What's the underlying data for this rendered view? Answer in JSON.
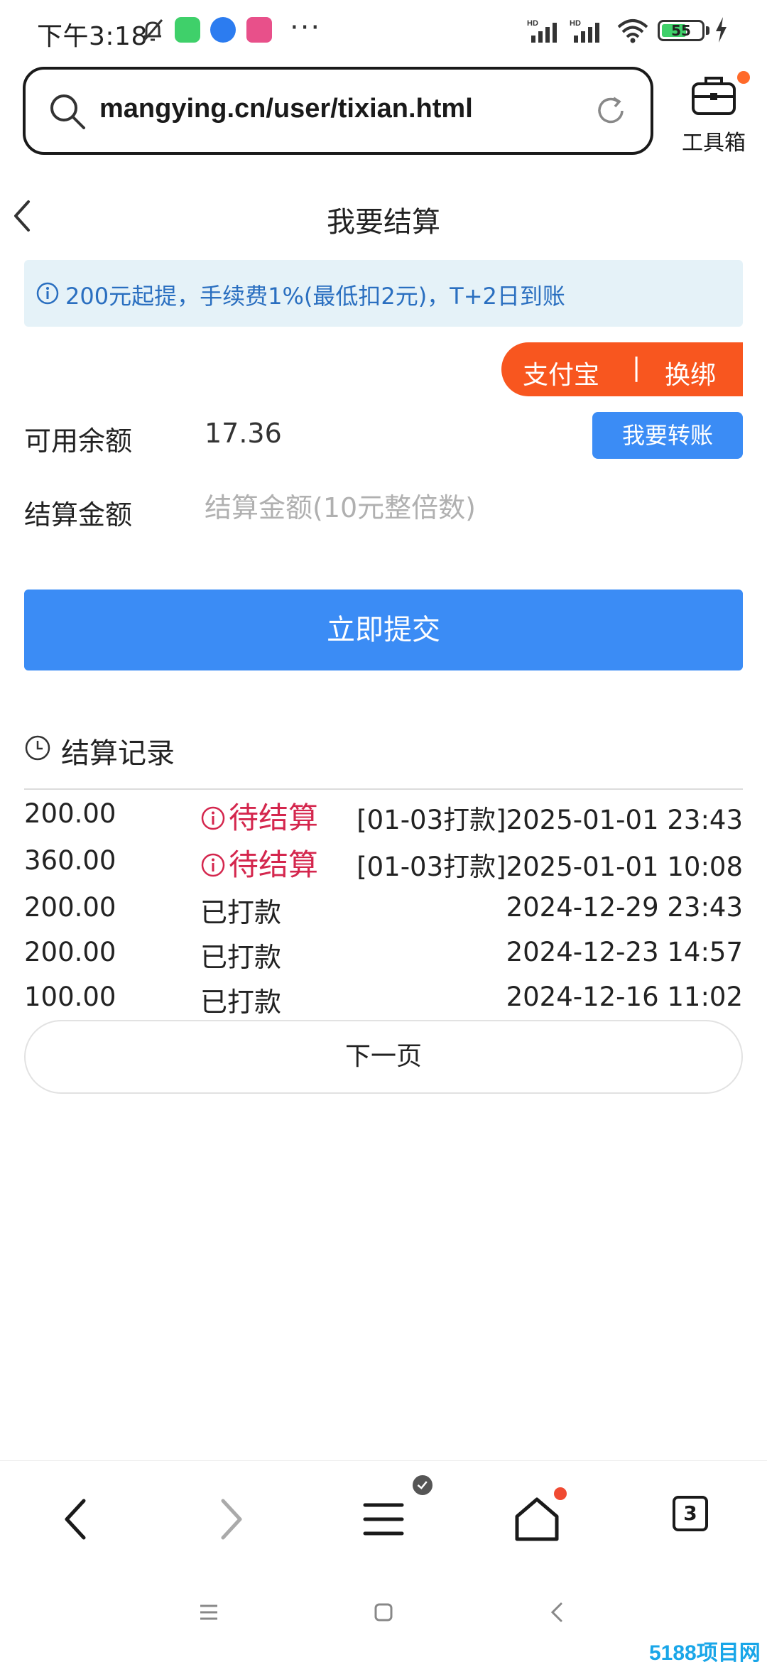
{
  "status_bar": {
    "time": "下午3:18",
    "overflow": "···",
    "battery": "55",
    "network_badge_1": "HD",
    "network_badge_2": "HD",
    "icons": [
      "bell-muted-icon",
      "chat-app-icon",
      "compass-app-icon",
      "file-app-icon",
      "signal-icon",
      "wifi-icon",
      "battery-icon",
      "charging-icon"
    ]
  },
  "browser": {
    "url": "mangying.cn/user/tixian.html",
    "toolbox_label": "工具箱",
    "tabs_count": "3"
  },
  "page": {
    "title": "我要结算",
    "notice": "200元起提，手续费1%(最低扣2元)，T+2日到账"
  },
  "account": {
    "name": "支付宝",
    "separator": "|",
    "rebind": "换绑"
  },
  "balance": {
    "label": "可用余额",
    "value": "17.36",
    "transfer_button": "我要转账"
  },
  "amount": {
    "label": "结算金额",
    "placeholder": "结算金额(10元整倍数)",
    "value": ""
  },
  "submit_button": "立即提交",
  "records": {
    "title": "结算记录",
    "rows": [
      {
        "amount": "200.00",
        "status": "待结算",
        "pending": true,
        "date": "[01-03打款]2025-01-01 23:43"
      },
      {
        "amount": "360.00",
        "status": "待结算",
        "pending": true,
        "date": "[01-03打款]2025-01-01 10:08"
      },
      {
        "amount": "200.00",
        "status": "已打款",
        "pending": false,
        "date": "2024-12-29 23:43"
      },
      {
        "amount": "200.00",
        "status": "已打款",
        "pending": false,
        "date": "2024-12-23 14:57"
      },
      {
        "amount": "100.00",
        "status": "已打款",
        "pending": false,
        "date": "2024-12-16 11:02"
      }
    ],
    "next_page": "下一页"
  },
  "colors": {
    "primary": "#3b8cf5",
    "account_pill": "#f8561f",
    "pending": "#d4264d",
    "notice_bg": "#e5f2f8",
    "notice_text": "#2a6fc0"
  },
  "watermark": "5188项目网"
}
